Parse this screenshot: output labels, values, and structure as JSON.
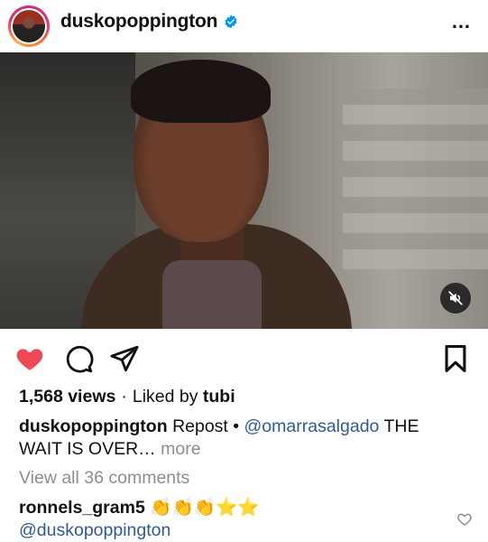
{
  "header": {
    "username": "duskopoppington",
    "more_label": "…"
  },
  "media": {
    "muted": true
  },
  "actions": {
    "liked": true,
    "colors": {
      "like": "#ed4956",
      "verified": "#0095f6",
      "link": "#2f5a96"
    }
  },
  "stats": {
    "views": "1,568 views",
    "separator": "·",
    "liked_by_prefix": "Liked by",
    "liked_by_user": "tubi"
  },
  "caption": {
    "author": "duskopoppington",
    "text_before": "Repost •",
    "mention": "@omarrasalgado",
    "text_after": "THE",
    "line2": "WAIT IS OVER…",
    "more": "more"
  },
  "comments": {
    "view_all": "View all 36 comments",
    "preview": {
      "author": "ronnels_gram5",
      "emojis": "👏👏👏⭐⭐",
      "mention": "@duskopoppington"
    }
  }
}
